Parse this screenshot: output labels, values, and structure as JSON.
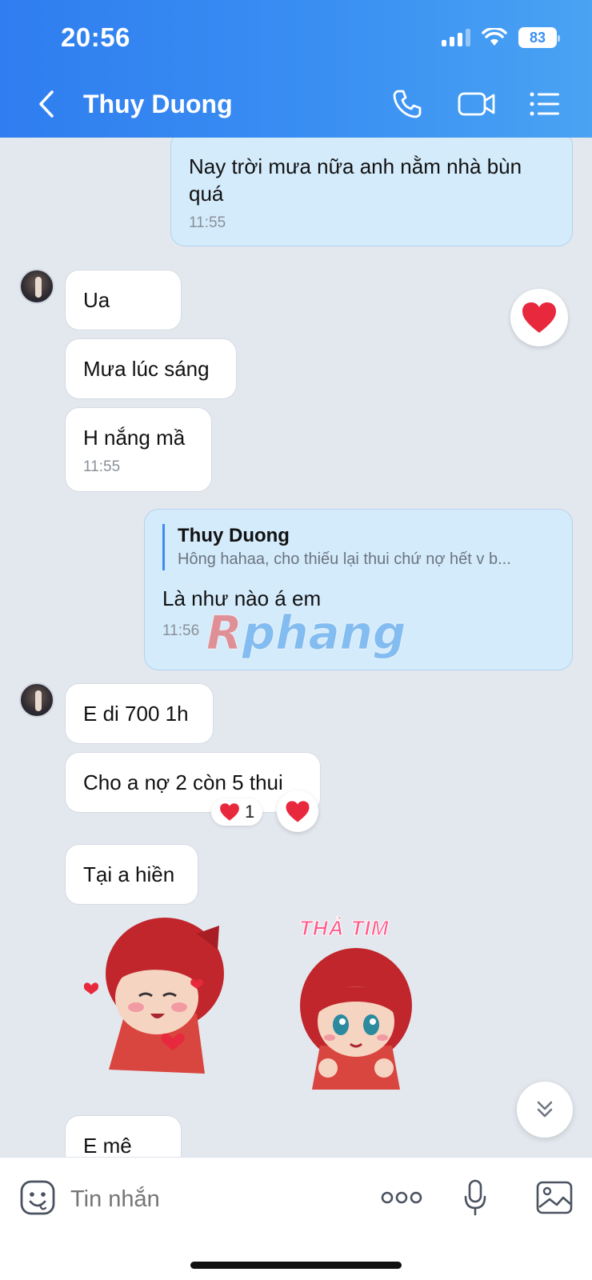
{
  "status_bar": {
    "time": "20:56",
    "battery": "83"
  },
  "nav": {
    "title": "Thuy Duong",
    "back_icon": "chevron-left-icon",
    "call_icon": "phone-icon",
    "video_icon": "video-icon",
    "menu_icon": "list-icon"
  },
  "messages": {
    "m1": {
      "text": "Nay trời mưa nữa anh nằm nhà bùn quá",
      "time": "11:55"
    },
    "m2": {
      "text": "Ua"
    },
    "m3": {
      "text": "Mưa lúc sáng"
    },
    "m4": {
      "text": "H nắng mầ",
      "time": "11:55"
    },
    "m5": {
      "quote_name": "Thuy Duong",
      "quote_text": "Hông hahaa, cho thiếu lại thui chứ nợ hết v b...",
      "text": "Là như nào á em",
      "time": "11:56"
    },
    "m6": {
      "text": "E di 700 1h"
    },
    "m7": {
      "text": "Cho a nợ 2 còn 5 thui",
      "reaction_count": "1"
    },
    "m8": {
      "text": "Tại a hiền"
    },
    "m9": {
      "text": "E mê"
    },
    "sticker_left": {
      "icon": "love-sticker-icon"
    },
    "sticker_right": {
      "label": "THẢ TIM"
    }
  },
  "watermark": {
    "text": "phang",
    "initial": "R"
  },
  "composer": {
    "placeholder": "Tin nhắn",
    "emoji_icon": "emoji-icon",
    "more_icon": "more-dots-icon",
    "mic_icon": "mic-icon",
    "image_icon": "image-icon"
  },
  "colors": {
    "header_start": "#2f7df0",
    "header_end": "#4aa3f3",
    "bubble_out": "#d4ebfb",
    "bubble_in": "#ffffff",
    "background": "#e3e8ef",
    "heart": "#e8283c"
  }
}
